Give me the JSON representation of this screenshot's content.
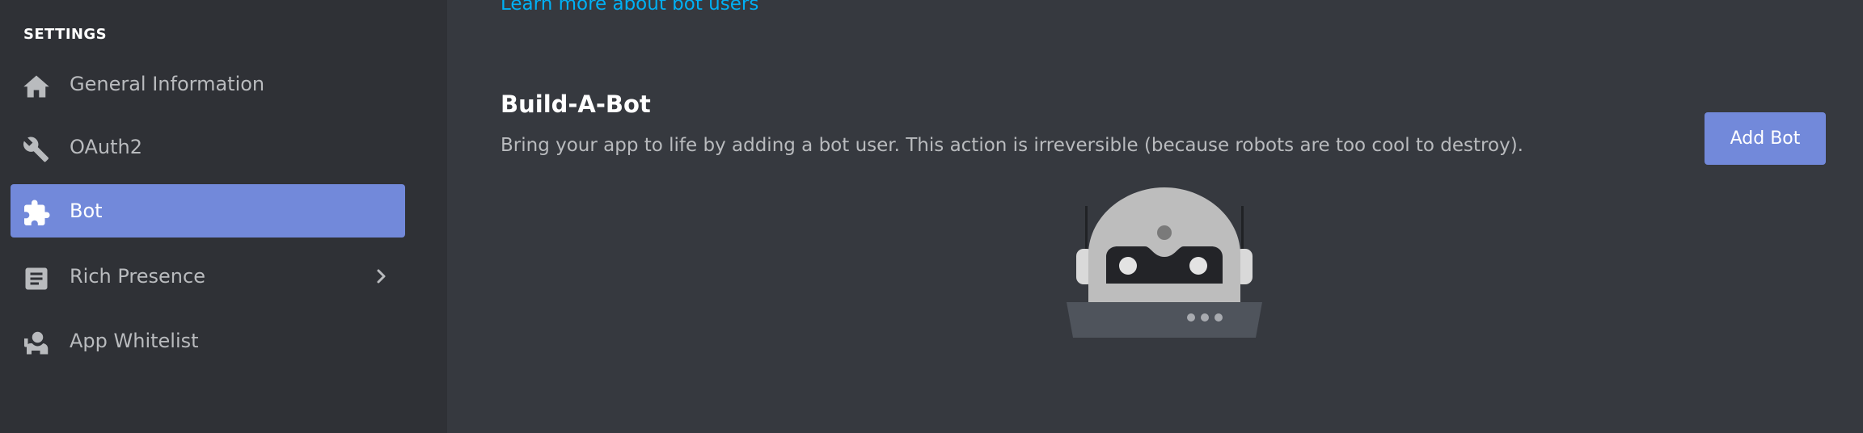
{
  "sidebar": {
    "heading": "SETTINGS",
    "items": [
      {
        "label": "General Information",
        "icon": "home-icon",
        "active": false
      },
      {
        "label": "OAuth2",
        "icon": "wrench-icon",
        "active": false
      },
      {
        "label": "Bot",
        "icon": "puzzle-icon",
        "active": true
      },
      {
        "label": "Rich Presence",
        "icon": "document-icon",
        "active": false,
        "has_chevron": true
      },
      {
        "label": "App Whitelist",
        "icon": "user-icon",
        "active": false
      }
    ]
  },
  "main": {
    "learn_link": "Learn more about bot users",
    "section_title": "Build-A-Bot",
    "section_description": "Bring your app to life by adding a bot user. This action is irreversible (because robots are too cool to destroy).",
    "add_bot_label": "Add Bot",
    "illustration": "robot-illustration"
  },
  "colors": {
    "sidebar_bg": "#2f3136",
    "main_bg": "#36393f",
    "accent": "#7289da",
    "link": "#00b0f4",
    "text_muted": "#b9bbbe",
    "text_primary": "#ffffff"
  }
}
